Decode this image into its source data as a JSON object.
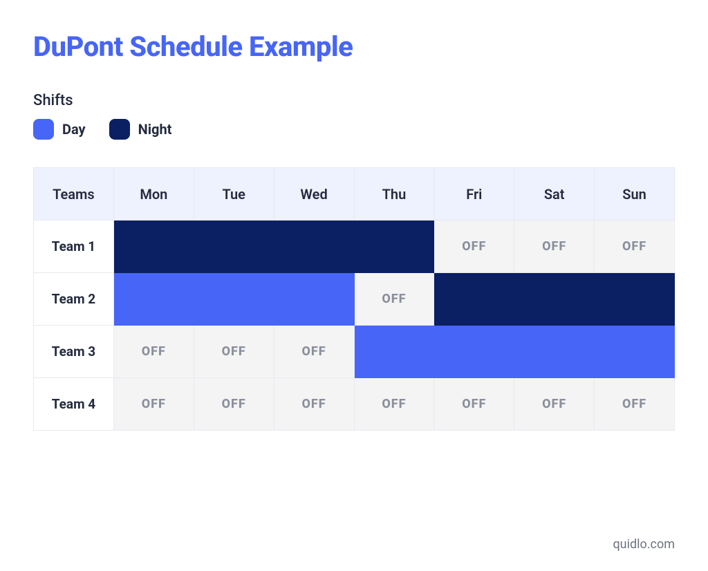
{
  "title": "DuPont Schedule Example",
  "shifts_label": "Shifts",
  "legend": {
    "day": {
      "label": "Day",
      "color": "#4765f6"
    },
    "night": {
      "label": "Night",
      "color": "#0b1f63"
    }
  },
  "off_label": "OFF",
  "table": {
    "corner_label": "Teams",
    "days": [
      "Mon",
      "Tue",
      "Wed",
      "Thu",
      "Fri",
      "Sat",
      "Sun"
    ],
    "teams": [
      "Team 1",
      "Team 2",
      "Team 3",
      "Team 4"
    ],
    "grid": [
      [
        "night",
        "night",
        "night",
        "night",
        "off",
        "off",
        "off"
      ],
      [
        "day",
        "day",
        "day",
        "off",
        "night",
        "night",
        "night"
      ],
      [
        "off",
        "off",
        "off",
        "day",
        "day",
        "day",
        "day"
      ],
      [
        "off",
        "off",
        "off",
        "off",
        "off",
        "off",
        "off"
      ]
    ]
  },
  "attribution": "quidlo.com"
}
